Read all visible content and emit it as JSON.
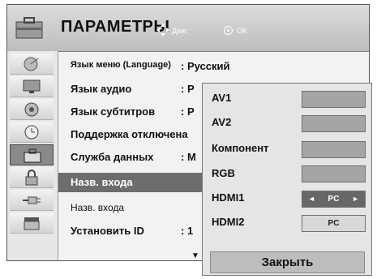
{
  "header": {
    "title": "ПАРАМЕТРЫ",
    "nav_label": "Двиг",
    "ok_label": "OK"
  },
  "sidebar": {
    "icons": [
      "satellite-icon",
      "monitor-icon",
      "speaker-icon",
      "clock-icon",
      "toolbox-icon",
      "lock-icon",
      "plug-icon",
      "clapperboard-icon"
    ],
    "active_index": 4
  },
  "menu": {
    "items": [
      {
        "label": "Язык меню (Language)",
        "value": ": Русский"
      },
      {
        "label": "Язык аудио",
        "value": ": Р"
      },
      {
        "label": "Язык субтитров",
        "value": ": Р"
      },
      {
        "label": "Поддержка отключена",
        "value": ""
      },
      {
        "label": "Служба данных",
        "value": ": М"
      },
      {
        "label": "Назв. входа",
        "value": ""
      },
      {
        "label": "Назв. входа",
        "value": ""
      },
      {
        "label": "Установить ID",
        "value": ": 1"
      }
    ],
    "selected_index": 5,
    "scroll_down": "▼"
  },
  "popup": {
    "inputs": [
      {
        "label": "AV1",
        "value": ""
      },
      {
        "label": "AV2",
        "value": ""
      },
      {
        "label": "Компонент",
        "value": ""
      },
      {
        "label": "RGB",
        "value": ""
      },
      {
        "label": "HDMI1",
        "value": "PC"
      },
      {
        "label": "HDMI2",
        "value": "PC"
      }
    ],
    "left_arrow": "◄",
    "right_arrow": "►",
    "close_label": "Закрыть"
  }
}
